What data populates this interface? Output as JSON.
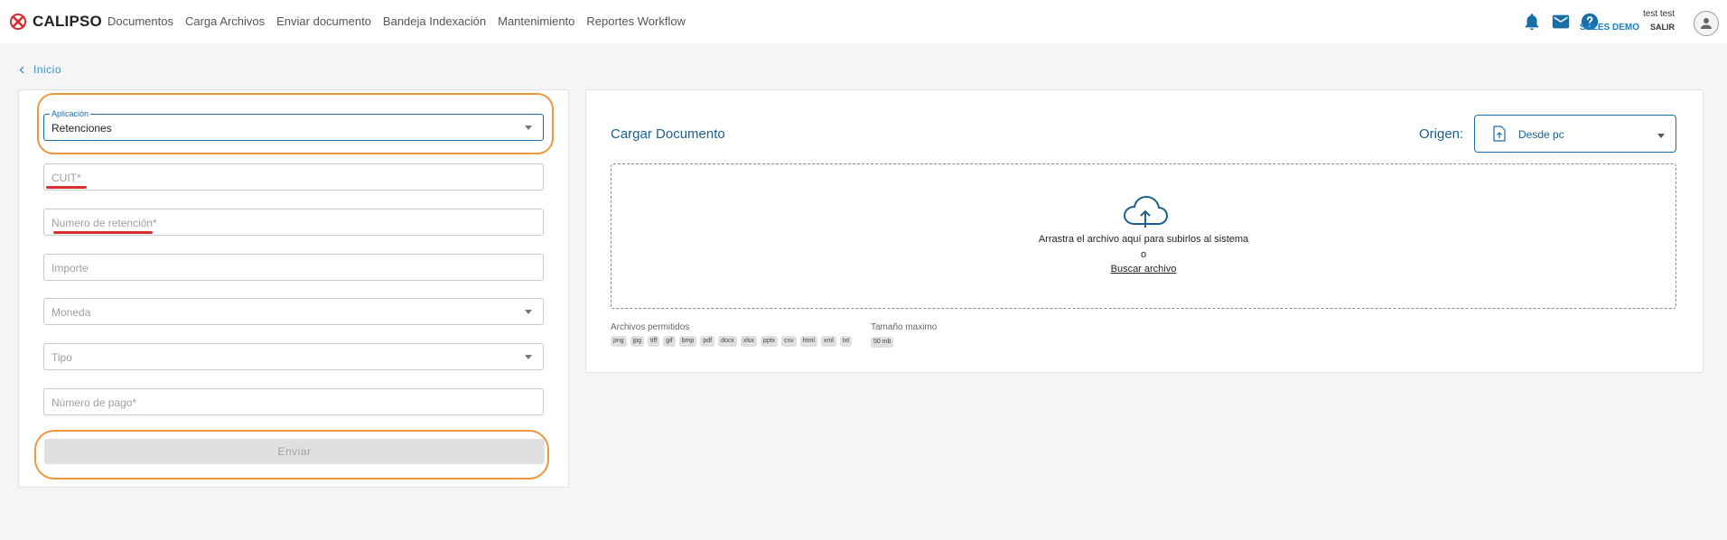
{
  "app": {
    "brand": "CALIPSO"
  },
  "nav": {
    "items": [
      "Documentos",
      "Carga Archivos",
      "Enviar documento",
      "Bandeja Indexación",
      "Mantenimiento",
      "Reportes Workflow"
    ]
  },
  "user": {
    "name": "test test",
    "company": "SALES DEMO",
    "logout": "SALIR"
  },
  "icons": [
    "bell-icon",
    "mail-icon",
    "help-icon",
    "user-avatar-icon",
    "chevron-left-icon",
    "cloud-upload-icon",
    "file-upload-icon",
    "chevron-down-icon"
  ],
  "breadcrumb": {
    "label": "Inicio"
  },
  "form": {
    "aplicacion": {
      "label": "Aplicación",
      "value": "Retenciones"
    },
    "cuit": {
      "placeholder": "CUIT*"
    },
    "numero_retencion": {
      "placeholder": "Numero de retención*"
    },
    "importe": {
      "placeholder": "Importe"
    },
    "moneda": {
      "placeholder": "Moneda"
    },
    "tipo": {
      "placeholder": "Tipo"
    },
    "numero_pago": {
      "placeholder": "Número de pago*"
    },
    "submit_label": "Enviar"
  },
  "upload": {
    "title": "Cargar Documento",
    "origin_label": "Origen:",
    "origin_value": "Desde pc",
    "drop_text": "Arrastra el archivo aquí para subirlos al sistema",
    "or_text": "o",
    "browse_link": "Buscar archivo",
    "allowed_label": "Archivos permitidos",
    "allowed_types": [
      "png",
      "jpg",
      "tiff",
      "gif",
      "bmp",
      "pdf",
      "docx",
      "xlsx",
      "pptx",
      "csv",
      "html",
      "xml",
      "txt"
    ],
    "max_size_label": "Tamaño maximo",
    "max_size_value": "50 mb"
  },
  "colors": {
    "accent": "#1a6ea8",
    "highlight": "#f0953a",
    "error_mark": "#d63030",
    "brand_red": "#d9262b"
  }
}
